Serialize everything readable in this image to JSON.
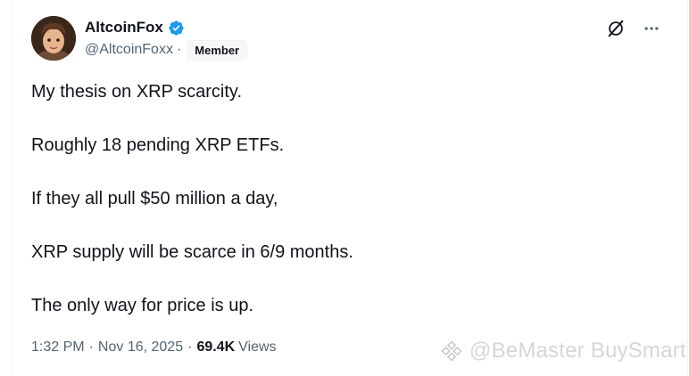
{
  "author": {
    "display_name": "AltcoinFox",
    "handle": "@AltcoinFoxx",
    "separator": "·",
    "badge": "Member",
    "verified_color": "#1d9bf0",
    "avatar_icon": "avatar-icon"
  },
  "actions": {
    "grok_icon": "grok-icon",
    "more_icon": "more-icon"
  },
  "tweet": {
    "lines": [
      "My thesis on XRP scarcity.",
      "Roughly 18 pending XRP ETFs.",
      "If they all pull $50 million a day,",
      "XRP supply will be scarce in 6/9 months.",
      "The only way for price is up."
    ]
  },
  "meta": {
    "time": "1:32 PM",
    "sep": "·",
    "date": "Nov 16, 2025",
    "views_count": "69.4K",
    "views_label": "Views"
  },
  "watermark": {
    "text": "@BeMaster BuySmart"
  }
}
